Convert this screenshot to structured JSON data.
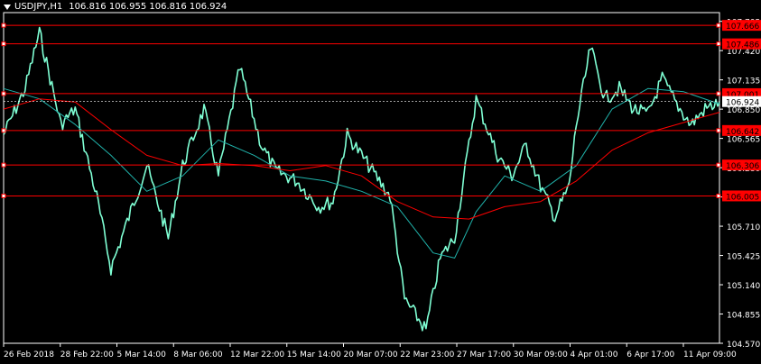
{
  "header": {
    "symbol": "USDJPY,H1",
    "ohlc": "106.816 106.955 106.816 106.924"
  },
  "colors": {
    "background": "#000000",
    "axis": "#ffffff",
    "candle": "#7fffd4",
    "price_line": "#ffffff",
    "level_line": "#ff0000",
    "ma_slow": "#ff0000",
    "ma_fast": "#20b2aa"
  },
  "chart_data": {
    "type": "line",
    "title": "USDJPY,H1",
    "ylim": [
      104.57,
      107.79
    ],
    "y_ticks": [
      "107.705",
      "107.420",
      "107.135",
      "106.850",
      "106.565",
      "106.280",
      "105.995",
      "105.710",
      "105.425",
      "105.140",
      "104.855",
      "104.570"
    ],
    "x_ticks": [
      "26 Feb 2018",
      "28 Feb 22:00",
      "5 Mar 14:00",
      "8 Mar 06:00",
      "12 Mar 22:00",
      "15 Mar 14:00",
      "20 Mar 07:00",
      "22 Mar 23:00",
      "27 Mar 17:00",
      "30 Mar 09:00",
      "4 Apr 01:00",
      "6 Apr 17:00",
      "11 Apr 09:00"
    ],
    "current_price": "106.924",
    "levels": [
      {
        "value": 107.666,
        "label": "107.666"
      },
      {
        "value": 107.486,
        "label": "107.486"
      },
      {
        "value": 107.001,
        "label": "107.001"
      },
      {
        "value": 106.642,
        "label": "106.642"
      },
      {
        "value": 106.306,
        "label": "106.306"
      },
      {
        "value": 106.005,
        "label": "106.005"
      }
    ],
    "series": [
      {
        "key": "price",
        "x": [
          0,
          3,
          5,
          8,
          10,
          13,
          15,
          18,
          20,
          23,
          25,
          28,
          30,
          33,
          36,
          38,
          41,
          44,
          46,
          48,
          51,
          54,
          56,
          59,
          61,
          63,
          66,
          69,
          71,
          73,
          75,
          77,
          79,
          80,
          82,
          84,
          86,
          88,
          90,
          92,
          94,
          96,
          98,
          100
        ],
        "values": [
          106.6,
          107.05,
          107.6,
          106.7,
          106.85,
          106.0,
          105.3,
          105.9,
          106.3,
          105.6,
          106.3,
          106.85,
          106.2,
          107.25,
          106.5,
          106.25,
          106.15,
          105.9,
          105.95,
          106.6,
          106.3,
          106.0,
          105.0,
          104.7,
          105.4,
          105.6,
          106.95,
          106.4,
          106.2,
          106.5,
          106.1,
          105.8,
          106.1,
          106.7,
          107.45,
          106.95,
          107.05,
          106.85,
          106.8,
          107.15,
          106.9,
          106.7,
          106.85,
          106.92
        ]
      },
      {
        "key": "ma_fast",
        "x": [
          0,
          5,
          10,
          15,
          20,
          25,
          30,
          35,
          40,
          45,
          50,
          55,
          60,
          63,
          66,
          70,
          75,
          80,
          85,
          90,
          95,
          100
        ],
        "values": [
          107.05,
          106.95,
          106.7,
          106.4,
          106.05,
          106.2,
          106.55,
          106.4,
          106.2,
          106.15,
          106.05,
          105.9,
          105.45,
          105.4,
          105.85,
          106.2,
          106.05,
          106.3,
          106.85,
          107.05,
          107.02,
          106.9
        ]
      },
      {
        "key": "ma_slow",
        "x": [
          0,
          5,
          10,
          15,
          20,
          25,
          30,
          35,
          40,
          45,
          50,
          55,
          60,
          65,
          70,
          75,
          80,
          85,
          90,
          95,
          100
        ],
        "values": [
          106.85,
          106.95,
          106.92,
          106.65,
          106.4,
          106.3,
          106.32,
          106.3,
          106.25,
          106.3,
          106.2,
          105.95,
          105.8,
          105.78,
          105.9,
          105.95,
          106.15,
          106.45,
          106.62,
          106.72,
          106.82
        ]
      }
    ]
  }
}
